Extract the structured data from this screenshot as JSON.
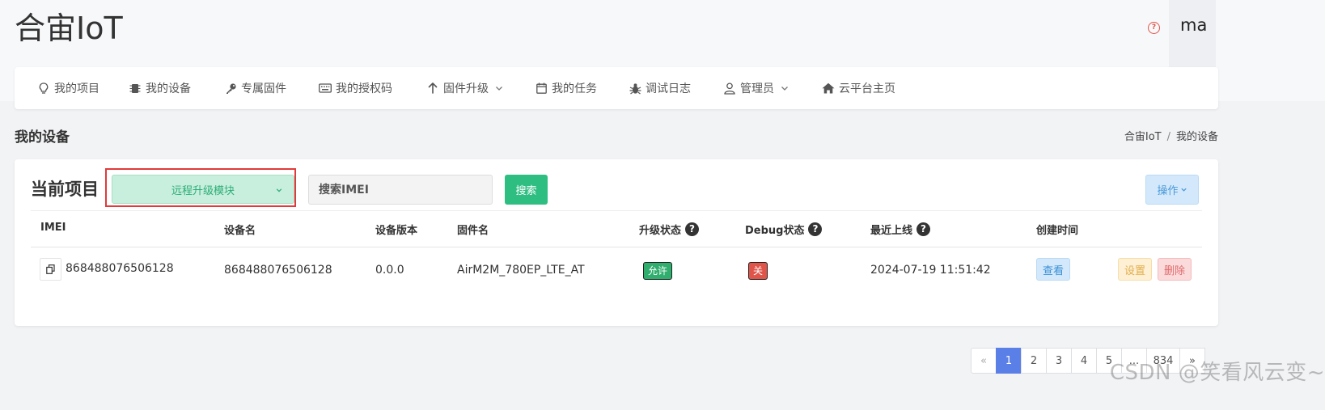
{
  "app": {
    "title": "合宙IoT",
    "user": "ma",
    "help_icon": "question-circle-icon"
  },
  "nav": {
    "items": [
      {
        "label": "我的项目",
        "icon": "lightbulb-icon"
      },
      {
        "label": "我的设备",
        "icon": "chip-icon"
      },
      {
        "label": "专属固件",
        "icon": "key-icon"
      },
      {
        "label": "我的授权码",
        "icon": "keyboard-icon"
      },
      {
        "label": "固件升级",
        "icon": "arrow-up-icon"
      },
      {
        "label": "我的任务",
        "icon": "calendar-icon"
      },
      {
        "label": "调试日志",
        "icon": "bug-icon"
      },
      {
        "label": "管理员",
        "icon": "user-icon"
      },
      {
        "label": "云平台主页",
        "icon": "home-icon"
      }
    ]
  },
  "page": {
    "heading": "我的设备",
    "breadcrumb": [
      "合宙IoT",
      "我的设备"
    ],
    "breadcrumb_sep": "/"
  },
  "toolbar": {
    "project_label": "当前项目",
    "project_selected": "远程升级模块",
    "search_placeholder": "搜索IMEI",
    "search_button": "搜索",
    "ops_button": "操作"
  },
  "table": {
    "headers": {
      "imei": "IMEI",
      "device_name": "设备名",
      "device_version": "设备版本",
      "firmware": "固件名",
      "upgrade_status": "升级状态",
      "debug_status": "Debug状态",
      "last_online": "最近上线",
      "created_time": "创建时间"
    },
    "rows": [
      {
        "imei": "868488076506128",
        "device_name": "868488076506128",
        "device_version": "0.0.0",
        "firmware": "AirM2M_780EP_LTE_AT",
        "upgrade_status": "允许",
        "debug_status": "关",
        "last_online": "2024-07-19 11:51:42",
        "view_button": "查看",
        "settings_button": "设置",
        "delete_button": "删除"
      }
    ]
  },
  "pagination": {
    "prev": "«",
    "pages": [
      "1",
      "2",
      "3",
      "4",
      "5",
      "...",
      "834"
    ],
    "next": "»",
    "active": "1"
  },
  "watermark": "CSDN @笑看风云变~",
  "colors": {
    "primary_green": "#2fbe82",
    "highlight_red": "#e23a3a",
    "active_page_blue": "#5a7fe6",
    "view_blue": "#3a8fd6"
  }
}
